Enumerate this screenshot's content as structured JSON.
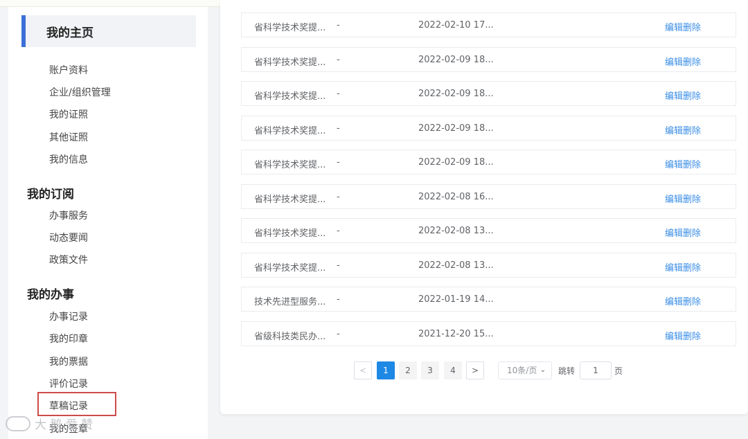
{
  "sidebar": {
    "home_title": "我的主页",
    "home_items": [
      "账户资料",
      "企业/组织管理",
      "我的证照",
      "其他证照",
      "我的信息"
    ],
    "subscription_title": "我的订阅",
    "subscription_items": [
      "办事服务",
      "动态要闻",
      "政策文件"
    ],
    "affairs_title": "我的办事",
    "affairs_items": [
      "办事记录",
      "我的印章",
      "我的票据",
      "评价记录",
      "草稿记录",
      "我的签章"
    ],
    "highlighted_item": "草稿记录"
  },
  "watermark": {
    "text": "大 鹅 爱 赞"
  },
  "records": [
    {
      "name": "省科学技术奖提...",
      "status": "-",
      "date": "2022-02-10 17...",
      "edit": "编辑",
      "delete": "删除"
    },
    {
      "name": "省科学技术奖提...",
      "status": "-",
      "date": "2022-02-09 18...",
      "edit": "编辑",
      "delete": "删除"
    },
    {
      "name": "省科学技术奖提...",
      "status": "-",
      "date": "2022-02-09 18...",
      "edit": "编辑",
      "delete": "删除"
    },
    {
      "name": "省科学技术奖提...",
      "status": "-",
      "date": "2022-02-09 18...",
      "edit": "编辑",
      "delete": "删除"
    },
    {
      "name": "省科学技术奖提...",
      "status": "-",
      "date": "2022-02-09 18...",
      "edit": "编辑",
      "delete": "删除"
    },
    {
      "name": "省科学技术奖提...",
      "status": "-",
      "date": "2022-02-08 16...",
      "edit": "编辑",
      "delete": "删除"
    },
    {
      "name": "省科学技术奖提...",
      "status": "-",
      "date": "2022-02-08 13...",
      "edit": "编辑",
      "delete": "删除"
    },
    {
      "name": "省科学技术奖提...",
      "status": "-",
      "date": "2022-02-08 13...",
      "edit": "编辑",
      "delete": "删除"
    },
    {
      "name": "技术先进型服务...",
      "status": "-",
      "date": "2022-01-19 14...",
      "edit": "编辑",
      "delete": "删除"
    },
    {
      "name": "省级科技类民办...",
      "status": "-",
      "date": "2021-12-20 15...",
      "edit": "编辑",
      "delete": "删除"
    }
  ],
  "pagination": {
    "prev": "<",
    "next": ">",
    "pages": [
      "1",
      "2",
      "3",
      "4"
    ],
    "current_page": "1",
    "page_size": "10条/页",
    "goto_label": "跳转",
    "goto_value": "1",
    "page_suffix": "页"
  },
  "colors": {
    "accent": "#3a6fd8",
    "link": "#3a8ee6",
    "highlight_box": "#cf4a4a"
  },
  "icons": {
    "size_dropdown": "chevron-down-icon"
  }
}
